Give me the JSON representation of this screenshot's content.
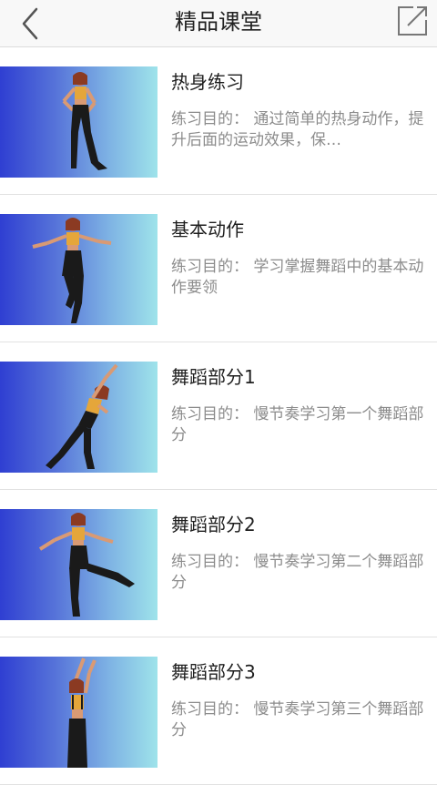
{
  "header": {
    "title": "精品课堂"
  },
  "lessons": [
    {
      "title": "热身练习",
      "description": "练习目的： 通过简单的热身动作，提升后面的运动效果，保…"
    },
    {
      "title": "基本动作",
      "description": "练习目的： 学习掌握舞蹈中的基本动作要领"
    },
    {
      "title": "舞蹈部分1",
      "description": "练习目的： 慢节奏学习第一个舞蹈部分"
    },
    {
      "title": "舞蹈部分2",
      "description": "练习目的： 慢节奏学习第二个舞蹈部分"
    },
    {
      "title": "舞蹈部分3",
      "description": "练习目的： 慢节奏学习第三个舞蹈部分"
    }
  ],
  "colors": {
    "title_text": "#1e1e1e",
    "desc_text": "#8c8c8c",
    "thumb_gradient_start": "#2f3fd2",
    "thumb_gradient_end": "#9ee3ea"
  },
  "icons": {
    "back": "chevron-left-icon",
    "share": "share-icon"
  }
}
